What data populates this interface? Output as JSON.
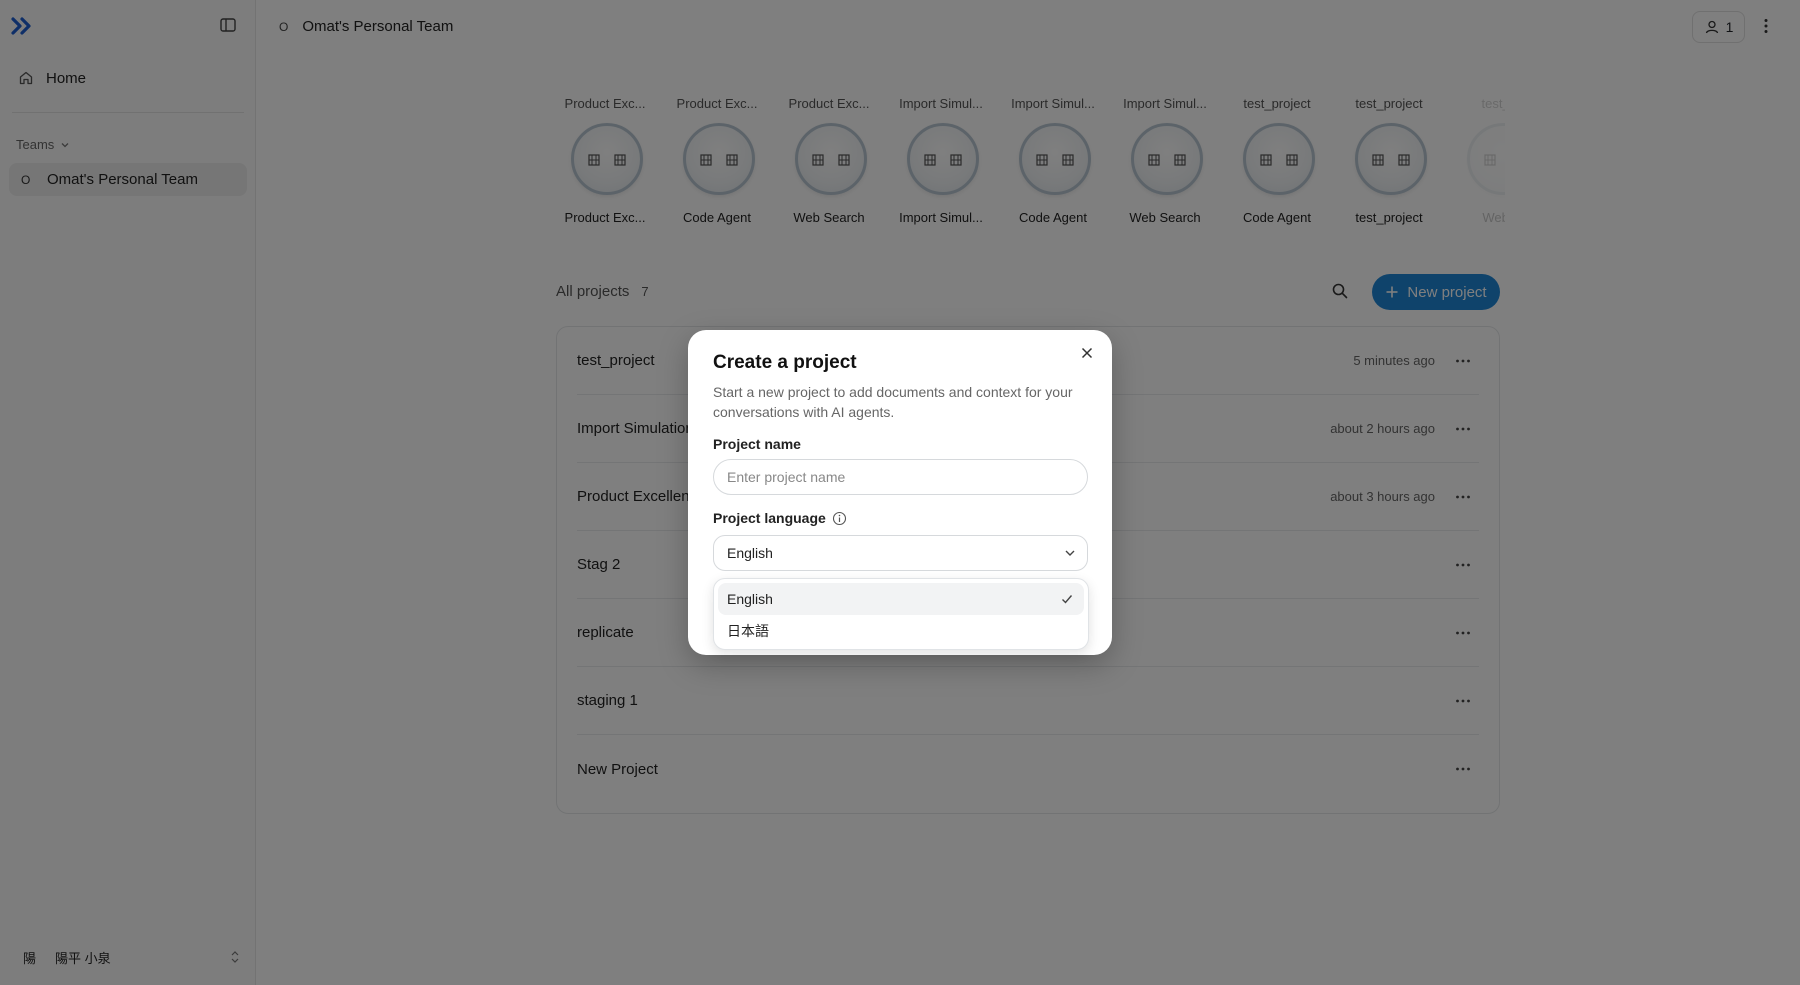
{
  "sidebar": {
    "home_label": "Home",
    "teams_label": "Teams",
    "team": {
      "initial": "O",
      "name": "Omat's Personal Team"
    },
    "user": {
      "initial": "陽",
      "name": "陽平 小泉"
    }
  },
  "header": {
    "team_initial": "O",
    "team_name": "Omat's Personal Team",
    "member_count": "1"
  },
  "agents": [
    {
      "project": "Product Exc...",
      "agent": "Product Exc..."
    },
    {
      "project": "Product Exc...",
      "agent": "Code Agent"
    },
    {
      "project": "Product Exc...",
      "agent": "Web Search"
    },
    {
      "project": "Import Simul...",
      "agent": "Import Simul..."
    },
    {
      "project": "Import Simul...",
      "agent": "Code Agent"
    },
    {
      "project": "Import Simul...",
      "agent": "Web Search"
    },
    {
      "project": "test_project",
      "agent": "Code Agent"
    },
    {
      "project": "test_project",
      "agent": "test_project"
    },
    {
      "project": "test_...",
      "agent": "Web..."
    }
  ],
  "projects": {
    "title": "All projects",
    "count": "7",
    "new_project_label": "New project",
    "rows": [
      {
        "name": "test_project",
        "time": "5 minutes ago"
      },
      {
        "name": "Import Simulation",
        "time": "about 2 hours ago"
      },
      {
        "name": "Product Excellence",
        "time": "about 3 hours ago"
      },
      {
        "name": "Stag 2",
        "time": ""
      },
      {
        "name": "replicate",
        "time": ""
      },
      {
        "name": "staging 1",
        "time": ""
      },
      {
        "name": "New Project",
        "time": ""
      }
    ]
  },
  "modal": {
    "title": "Create a project",
    "description": "Start a new project to add documents and context for your conversations with AI agents.",
    "name_label": "Project name",
    "name_placeholder": "Enter project name",
    "name_value": "",
    "language_label": "Project language",
    "language_selected": "English",
    "language_options": [
      {
        "label": "English",
        "selected": true
      },
      {
        "label": "日本語",
        "selected": false
      }
    ]
  },
  "colors": {
    "accent": "#1f86d6",
    "logo": "#1e5fd1"
  }
}
